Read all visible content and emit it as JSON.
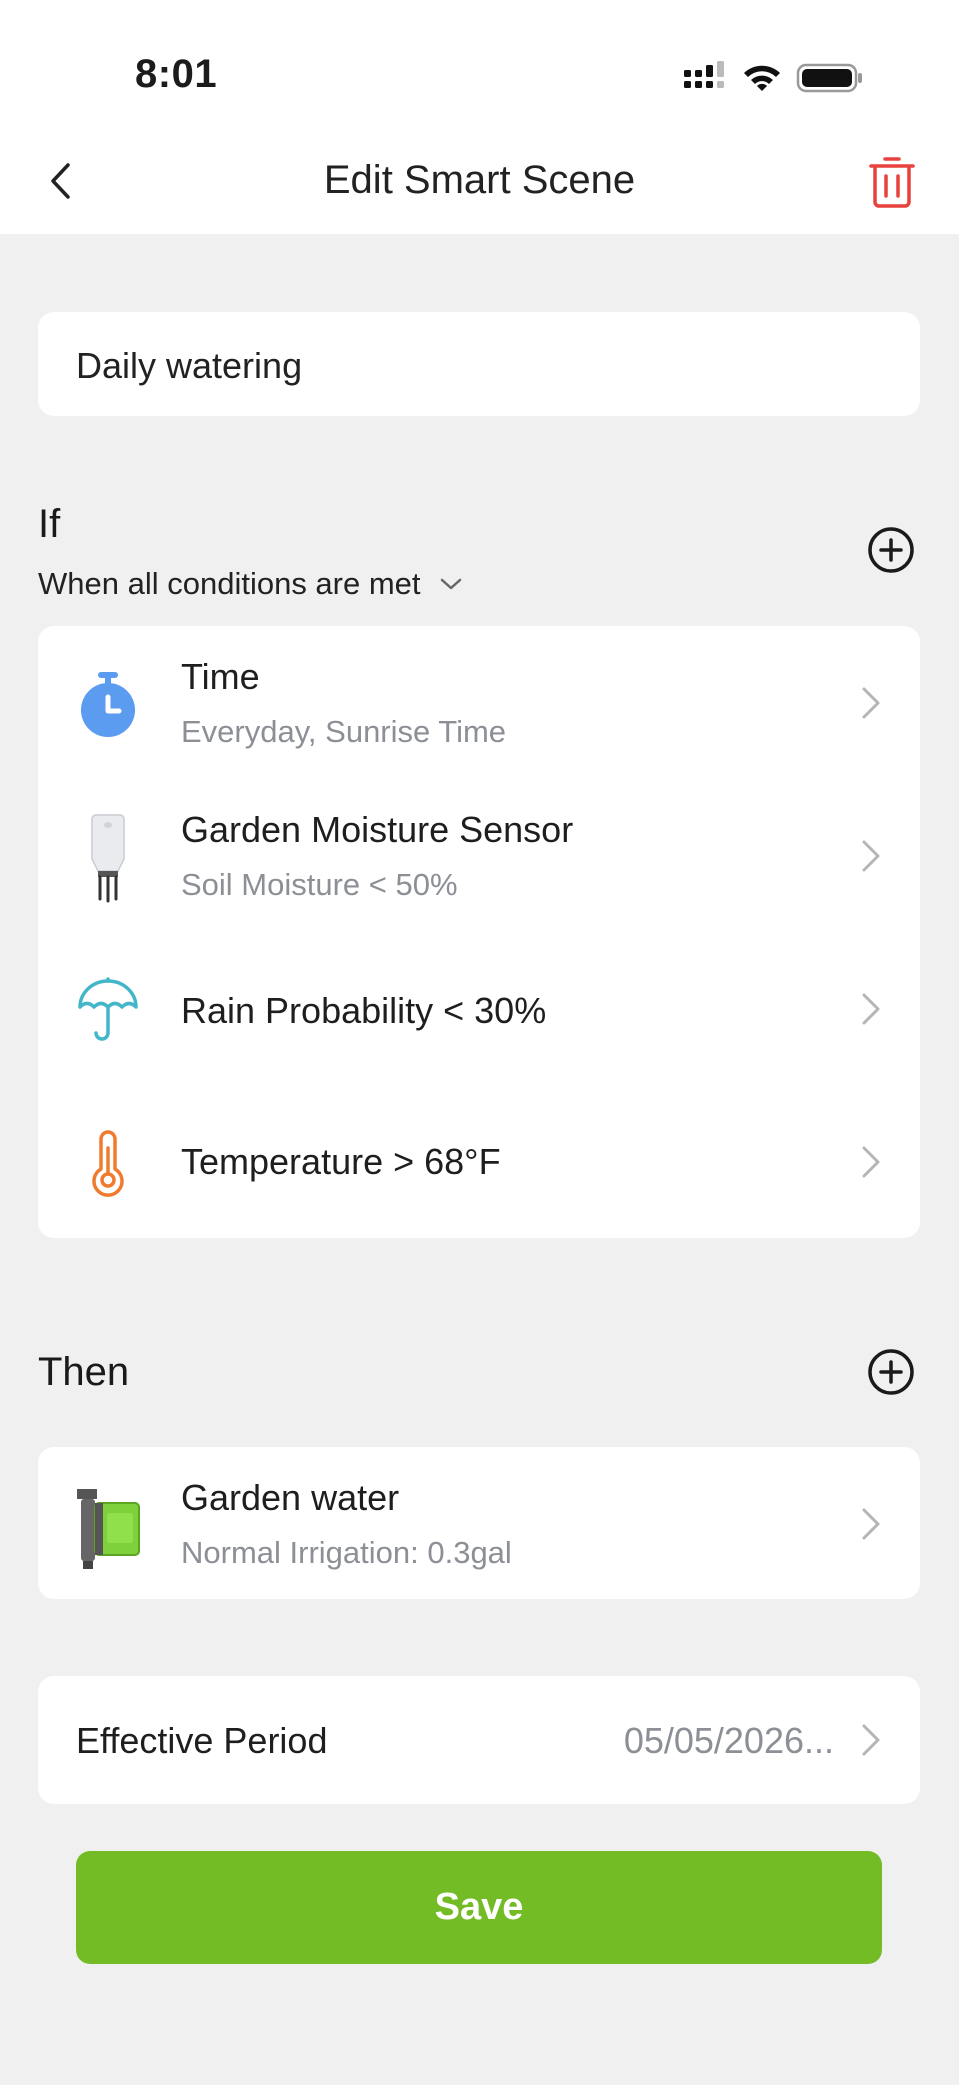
{
  "status_bar": {
    "time": "8:01"
  },
  "nav": {
    "title": "Edit Smart Scene"
  },
  "scene_name": "Daily watering",
  "if_section": {
    "title": "If",
    "condition_mode": "When all conditions are met",
    "conditions": [
      {
        "title": "Time",
        "subtitle": "Everyday, Sunrise Time",
        "icon": "clock-icon",
        "color": "#5b9bf0"
      },
      {
        "title": "Garden Moisture Sensor",
        "subtitle": "Soil Moisture < 50%",
        "icon": "moisture-sensor-icon"
      },
      {
        "title": "Rain Probability < 30%",
        "icon": "umbrella-icon",
        "color": "#43b6c9"
      },
      {
        "title": "Temperature > 68°F",
        "icon": "thermometer-icon",
        "color": "#f07a2e"
      }
    ]
  },
  "then_section": {
    "title": "Then",
    "actions": [
      {
        "title": "Garden water",
        "subtitle": "Normal Irrigation: 0.3gal",
        "icon": "water-timer-icon"
      }
    ]
  },
  "effective_period": {
    "label": "Effective Period",
    "value": "05/05/2026..."
  },
  "save_label": "Save",
  "colors": {
    "accent": "#74bc26",
    "delete": "#e8423f",
    "background": "#f0f0f0"
  }
}
